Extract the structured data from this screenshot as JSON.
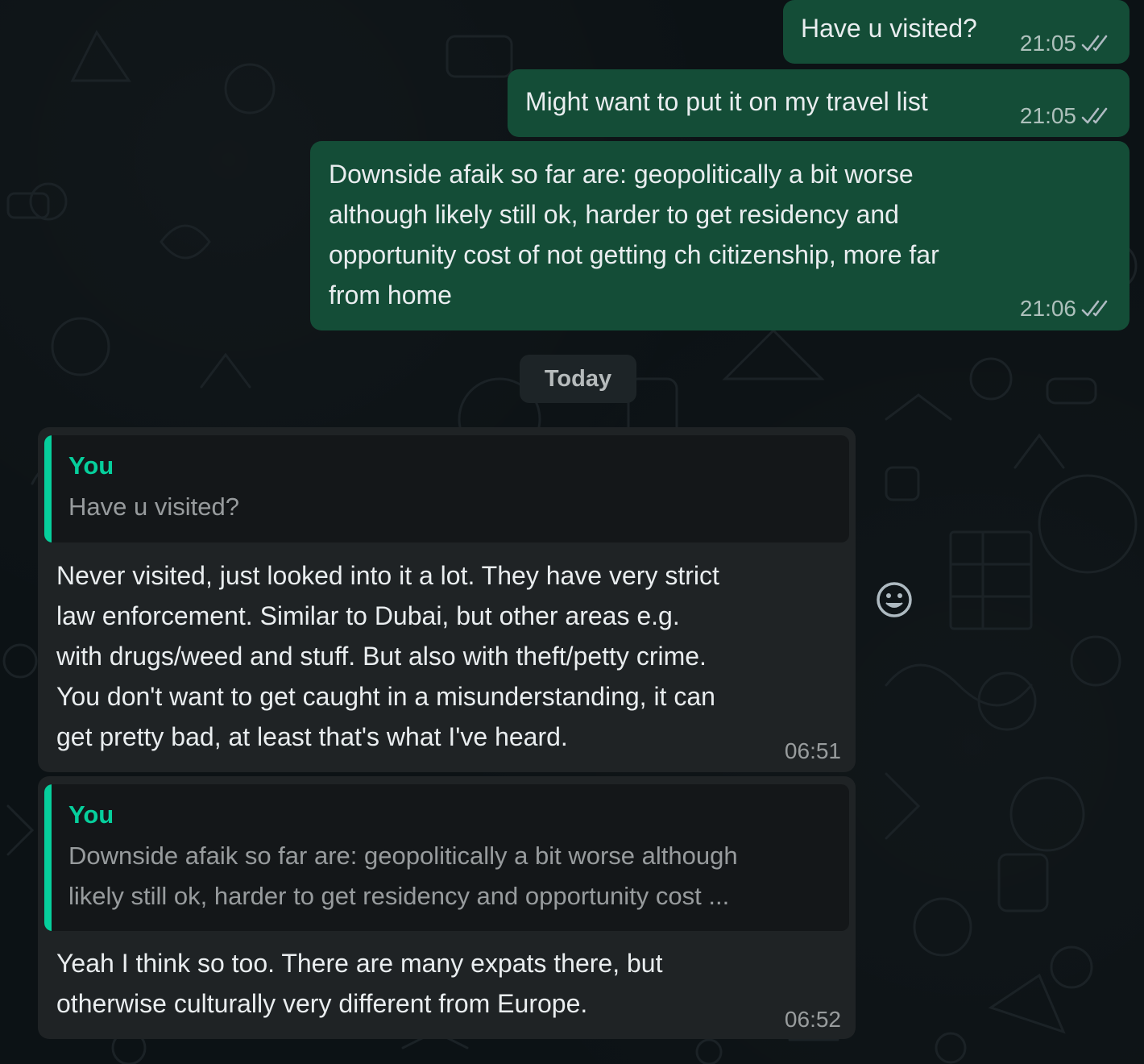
{
  "outgoing": [
    {
      "text": "Have u visited?",
      "time": "21:05"
    },
    {
      "text": "Might want to put it on my travel list",
      "time": "21:05"
    },
    {
      "text": "Downside afaik so far are: geopolitically a bit worse\nalthough likely still ok, harder to get residency and\nopportunity cost of not getting ch citizenship, more far\nfrom home",
      "time": "21:06"
    }
  ],
  "day_separator": "Today",
  "incoming": [
    {
      "quote_author": "You",
      "quote_text": "Have u visited?",
      "text": "Never visited, just looked into it a lot. They have very strict\nlaw enforcement. Similar to Dubai, but other areas e.g.\nwith drugs/weed and stuff. But also with theft/petty crime.\nYou don't want to get caught in a misunderstanding, it can\nget pretty bad, at least that's what I've heard.",
      "time": "06:51"
    },
    {
      "quote_author": "You",
      "quote_text": "Downside afaik so far are: geopolitically a bit worse although\nlikely still ok, harder to get residency and opportunity cost ...",
      "text": "Yeah I think so too. There are many expats there, but\notherwise culturally very different from Europe.",
      "time": "06:52"
    }
  ],
  "icons": {
    "read_receipt": "double-check-icon",
    "reaction": "smiley-icon"
  },
  "colors": {
    "outgoing_bubble": "#144d37",
    "incoming_bubble": "#1f2325",
    "quote_accent": "#06cf9c",
    "background": "#0c1215"
  }
}
